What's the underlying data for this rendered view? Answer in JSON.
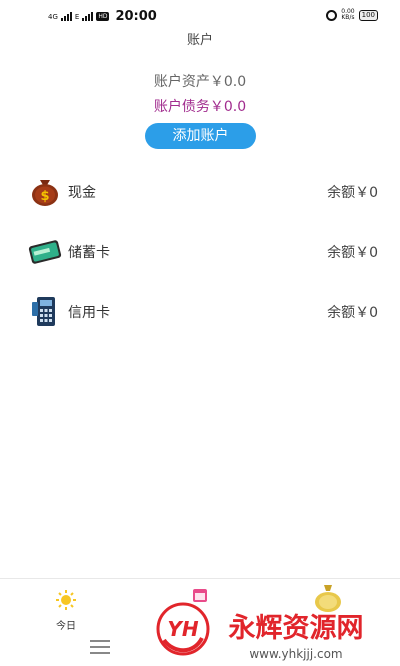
{
  "status_bar": {
    "net_4g": "4G",
    "net_e": "E",
    "hd": "HD",
    "time": "20:00",
    "speed_value": "0.00",
    "speed_unit": "KB/s",
    "battery": "100"
  },
  "header": {
    "title": "账户"
  },
  "summary": {
    "assets": "账户资产￥0.0",
    "debt": "账户债务￥0.0"
  },
  "add_button_label": "添加账户",
  "accounts": [
    {
      "name": "现金",
      "balance": "余额￥0",
      "icon": "money-bag-icon"
    },
    {
      "name": "储蓄卡",
      "balance": "余额￥0",
      "icon": "bank-card-icon"
    },
    {
      "name": "信用卡",
      "balance": "余额￥0",
      "icon": "card-terminal-icon"
    }
  ],
  "bottom_nav": {
    "today_label": "今日"
  },
  "watermark": {
    "brand": "永辉资源网",
    "logo": "YH",
    "url": "www.yhkjjj.com"
  },
  "colors": {
    "accent": "#2c9ee8",
    "debt": "#a12c8e",
    "watermark_red": "#e1252b"
  }
}
